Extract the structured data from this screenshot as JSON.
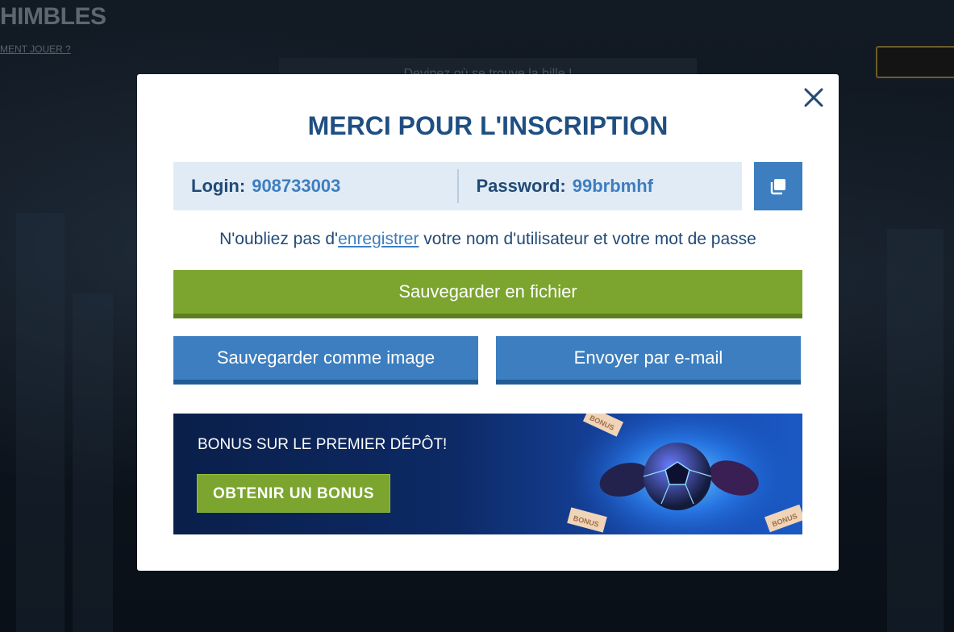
{
  "background_page": {
    "title": "HIMBLES",
    "how_to_link": "MENT JOUER ?",
    "hint": "Devinez où se trouve la bille !"
  },
  "modal": {
    "title": "MERCI POUR L'INSCRIPTION",
    "login_label": "Login:",
    "login_value": "908733003",
    "password_label": "Password:",
    "password_value": "99brbmhf",
    "reminder_before": "N'oubliez pas d'",
    "reminder_link": "enregistrer",
    "reminder_after": " votre nom d'utilisateur et votre mot de passe",
    "save_file_label": "Sauvegarder en fichier",
    "save_image_label": "Sauvegarder comme image",
    "send_email_label": "Envoyer par e-mail",
    "banner": {
      "text": "BONUS SUR LE PREMIER DÉPÔT!",
      "button_label": "OBTENIR UN BONUS",
      "ticket_text": "BONUS"
    }
  },
  "colors": {
    "title": "#1f4f82",
    "primary_blue": "#3c7ec0",
    "green": "#7ba52e",
    "cred_bg": "#e1ebf5"
  },
  "icons": {
    "close": "close-icon",
    "copy": "copy-icon"
  }
}
